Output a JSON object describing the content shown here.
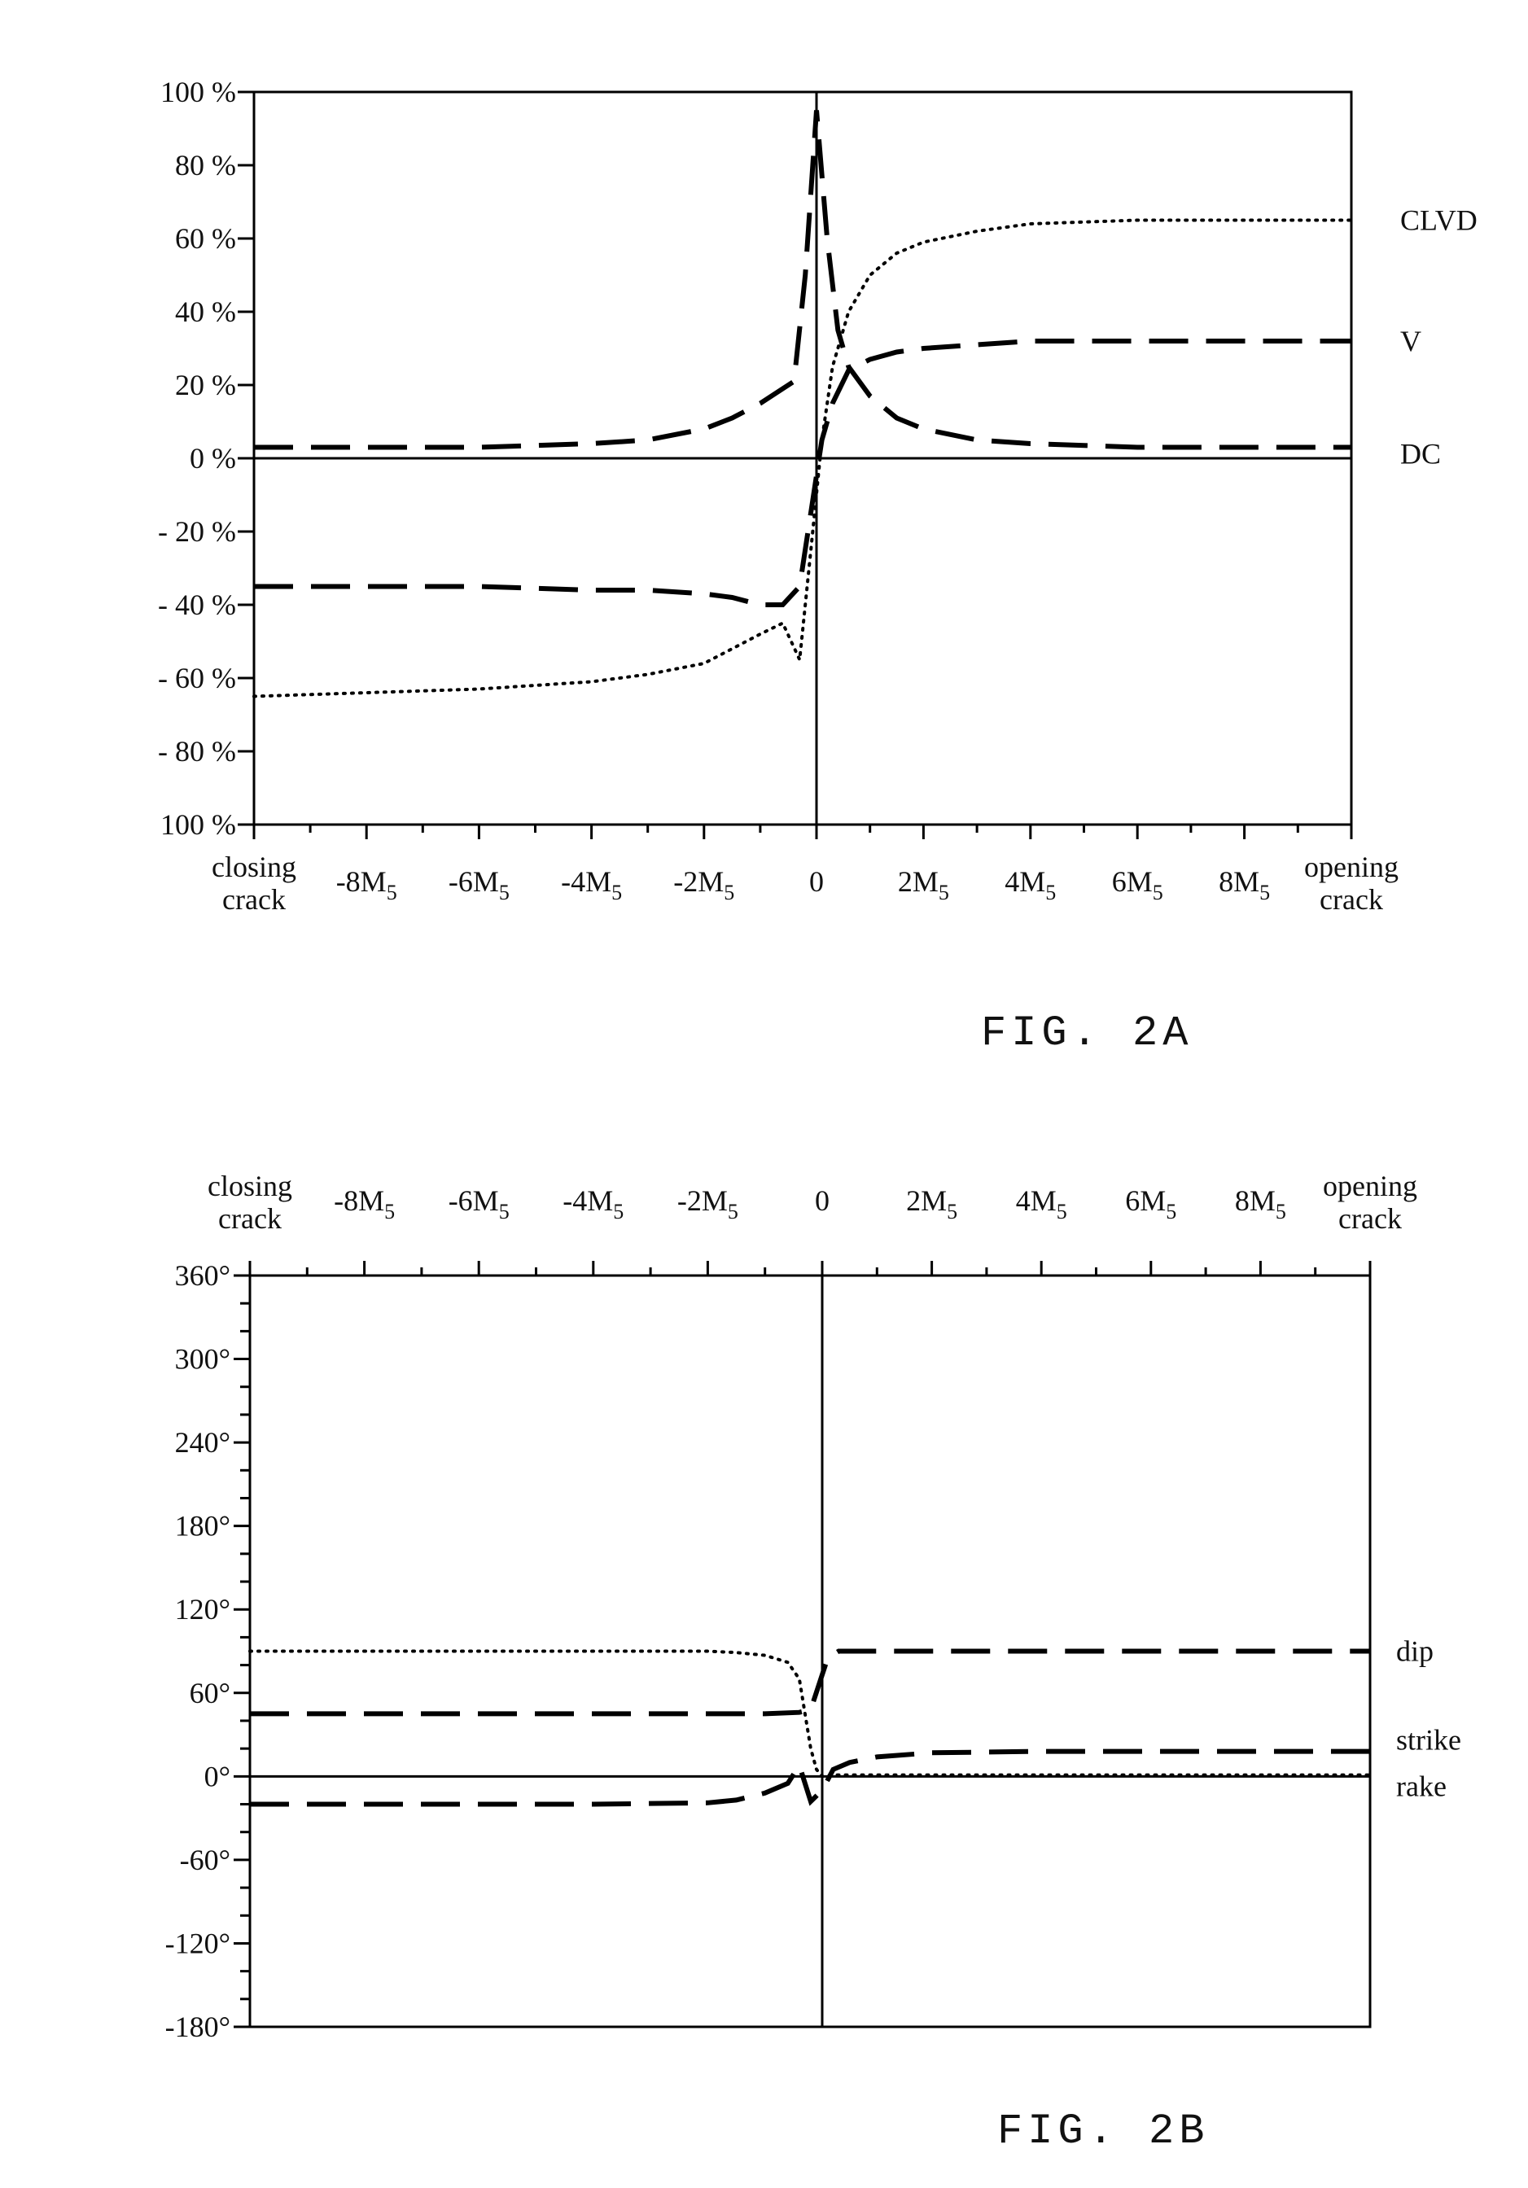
{
  "chart_data": [
    {
      "id": "fig2a",
      "type": "line",
      "figure_label": "FIG. 2A",
      "title": "",
      "xlabel": "",
      "ylabel": "",
      "x_tick_labels": [
        "closing crack",
        "-8M5",
        "-6M5",
        "-4M5",
        "-2M5",
        "0",
        "2M5",
        "4M5",
        "6M5",
        "8M5",
        "opening crack"
      ],
      "x_tick_values": [
        -10,
        -8,
        -6,
        -4,
        -2,
        0,
        2,
        4,
        6,
        8,
        10
      ],
      "xlim": [
        -10,
        10
      ],
      "y_tick_labels": [
        "100 %",
        "80 %",
        "60 %",
        "40 %",
        "20 %",
        "0 %",
        "- 20 %",
        "- 40 %",
        "- 60 %",
        "- 80 %",
        "100 %"
      ],
      "y_tick_values": [
        100,
        80,
        60,
        40,
        20,
        0,
        -20,
        -40,
        -60,
        -80,
        -100
      ],
      "ylim": [
        -100,
        100
      ],
      "grid": false,
      "legend_placement": "right (labels at line ends)",
      "series": [
        {
          "name": "CLVD",
          "style": "dotted",
          "x": [
            -10,
            -8,
            -6,
            -4,
            -3,
            -2,
            -1.5,
            -1,
            -0.6,
            -0.3,
            -0.1,
            0.1,
            0.3,
            0.6,
            1,
            1.5,
            2,
            3,
            4,
            6,
            8,
            10
          ],
          "y": [
            -65,
            -64,
            -63,
            -61,
            -59,
            -56,
            -52,
            -48,
            -45,
            -55,
            -25,
            5,
            25,
            40,
            50,
            56,
            59,
            62,
            64,
            65,
            65,
            65
          ]
        },
        {
          "name": "V",
          "style": "dashed",
          "x": [
            -10,
            -8,
            -6,
            -4,
            -3,
            -2,
            -1.5,
            -1,
            -0.6,
            -0.3,
            0.1,
            0.3,
            0.6,
            1,
            1.5,
            2,
            3,
            4,
            6,
            8,
            10
          ],
          "y": [
            -35,
            -35,
            -35,
            -36,
            -36,
            -37,
            -38,
            -40,
            -40,
            -35,
            5,
            15,
            24,
            27,
            29,
            30,
            31,
            32,
            32,
            32,
            32
          ]
        },
        {
          "name": "DC",
          "style": "dashed",
          "x": [
            -10,
            -8,
            -6,
            -4,
            -3,
            -2,
            -1.5,
            -1,
            -0.6,
            -0.4,
            -0.2,
            0,
            0.2,
            0.4,
            0.6,
            1,
            1.5,
            2,
            3,
            4,
            6,
            8,
            10
          ],
          "y": [
            3,
            3,
            3,
            4,
            5,
            8,
            11,
            15,
            19,
            21,
            50,
            95,
            60,
            35,
            25,
            17,
            11,
            8,
            5,
            4,
            3,
            3,
            3
          ]
        }
      ]
    },
    {
      "id": "fig2b",
      "type": "line",
      "figure_label": "FIG. 2B",
      "title": "",
      "xlabel": "",
      "ylabel": "",
      "x_tick_labels": [
        "closing crack",
        "-8M5",
        "-6M5",
        "-4M5",
        "-2M5",
        "0",
        "2M5",
        "4M5",
        "6M5",
        "8M5",
        "opening crack"
      ],
      "x_tick_values": [
        -10,
        -8,
        -6,
        -4,
        -2,
        0,
        2,
        4,
        6,
        8,
        10
      ],
      "xlim": [
        -10,
        10
      ],
      "x_axis_position": "top",
      "y_tick_labels": [
        "360°",
        "300°",
        "240°",
        "180°",
        "120°",
        "60°",
        "0°",
        "-60°",
        "-120°",
        "-180°"
      ],
      "y_tick_values": [
        360,
        300,
        240,
        180,
        120,
        60,
        0,
        -60,
        -120,
        -180
      ],
      "ylim": [
        -180,
        360
      ],
      "grid": false,
      "legend_placement": "right (labels at line ends)",
      "series": [
        {
          "name": "dip",
          "style": "dashed",
          "x": [
            -10,
            -8,
            -6,
            -4,
            -2,
            -1,
            -0.4,
            -0.2,
            0.1,
            0.3,
            1,
            2,
            4,
            6,
            8,
            10
          ],
          "y": [
            45,
            45,
            45,
            45,
            45,
            45,
            46,
            48,
            85,
            90,
            90,
            90,
            90,
            90,
            90,
            90
          ]
        },
        {
          "name": "strike",
          "style": "dashed",
          "x": [
            -10,
            -8,
            -6,
            -4,
            -2,
            -1.5,
            -1,
            -0.6,
            -0.4,
            -0.2,
            0,
            0.2,
            0.5,
            1,
            2,
            4,
            6,
            8,
            10
          ],
          "y": [
            -20,
            -20,
            -20,
            -20,
            -19,
            -17,
            -12,
            -5,
            8,
            -18,
            -10,
            5,
            10,
            14,
            17,
            18,
            18,
            18,
            18
          ]
        },
        {
          "name": "rake",
          "style": "dotted",
          "x": [
            -10,
            -8,
            -6,
            -4,
            -2,
            -1.5,
            -1,
            -0.6,
            -0.4,
            -0.3,
            -0.2,
            -0.1,
            0,
            0.2,
            0.5,
            1,
            2,
            4,
            6,
            8,
            10
          ],
          "y": [
            90,
            90,
            90,
            90,
            90,
            89,
            87,
            82,
            70,
            45,
            20,
            5,
            0,
            1,
            1,
            1,
            1,
            1,
            1,
            1,
            1
          ]
        }
      ]
    }
  ]
}
